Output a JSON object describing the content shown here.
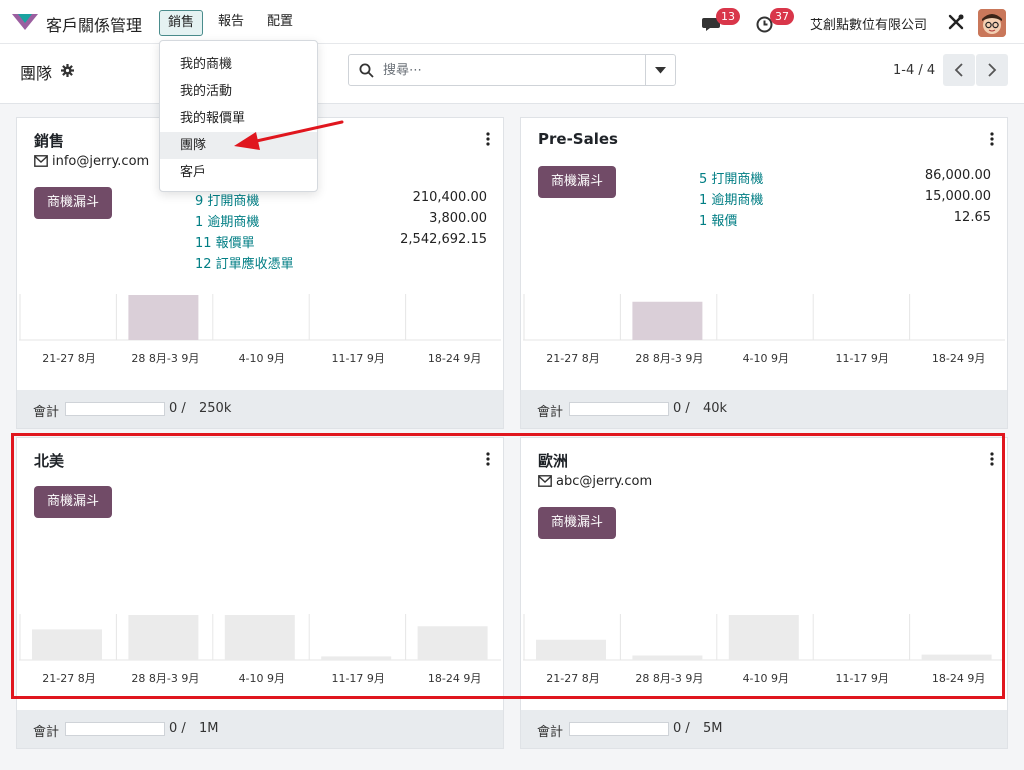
{
  "nav": {
    "app_title": "客戶關係管理",
    "menu": [
      "銷售",
      "報告",
      "配置"
    ],
    "messages_count": "13",
    "activities_count": "37",
    "company": "艾創點數位有限公司"
  },
  "control": {
    "page_title": "團隊",
    "search_placeholder": "搜尋⋯",
    "pager": "1-4 / 4"
  },
  "dropdown": {
    "items": [
      "我的商機",
      "我的活動",
      "我的報價單",
      "團隊",
      "客戶"
    ]
  },
  "pipeline_label": "商機漏斗",
  "footer_label": "會計",
  "graph_labels": [
    "21-27 8月",
    "28 8月-3 9月",
    "4-10 9月",
    "11-17 9月",
    "18-24 9月"
  ],
  "teams": [
    {
      "name": "銷售",
      "email": "info@jerry.com",
      "stats": [
        {
          "label": "9 打開商機",
          "amount": "210,400.00"
        },
        {
          "label": "1 逾期商機",
          "amount": "3,800.00"
        },
        {
          "label": "11 報價單",
          "amount": "2,542,692.15"
        },
        {
          "label": "12 訂單應收憑單",
          "amount": ""
        }
      ],
      "bars": [
        0,
        1,
        0,
        0,
        0
      ],
      "invoiced": "0 /",
      "target": "250k"
    },
    {
      "name": "Pre-Sales",
      "email": "",
      "stats": [
        {
          "label": "5 打開商機",
          "amount": "86,000.00"
        },
        {
          "label": "1 逾期商機",
          "amount": "15,000.00"
        },
        {
          "label": "1 報價",
          "amount": "12.65"
        }
      ],
      "bars": [
        0,
        0.85,
        0,
        0,
        0
      ],
      "invoiced": "0 /",
      "target": "40k"
    },
    {
      "name": "北美",
      "email": "",
      "stats": [],
      "bars": [
        0.68,
        1,
        1,
        0.08,
        0.75
      ],
      "invoiced": "0 /",
      "target": "1M"
    },
    {
      "name": "歐洲",
      "email": "abc@jerry.com",
      "stats": [],
      "bars": [
        0.45,
        0.1,
        1,
        0,
        0.12
      ],
      "invoiced": "0 /",
      "target": "5M"
    }
  ],
  "colors": {
    "accent": "#714b67",
    "link": "#017e84",
    "highlight_bar": "#dacfd8",
    "bar": "#ebebeb",
    "badge": "#d9364a",
    "annotation": "#e0161e"
  }
}
